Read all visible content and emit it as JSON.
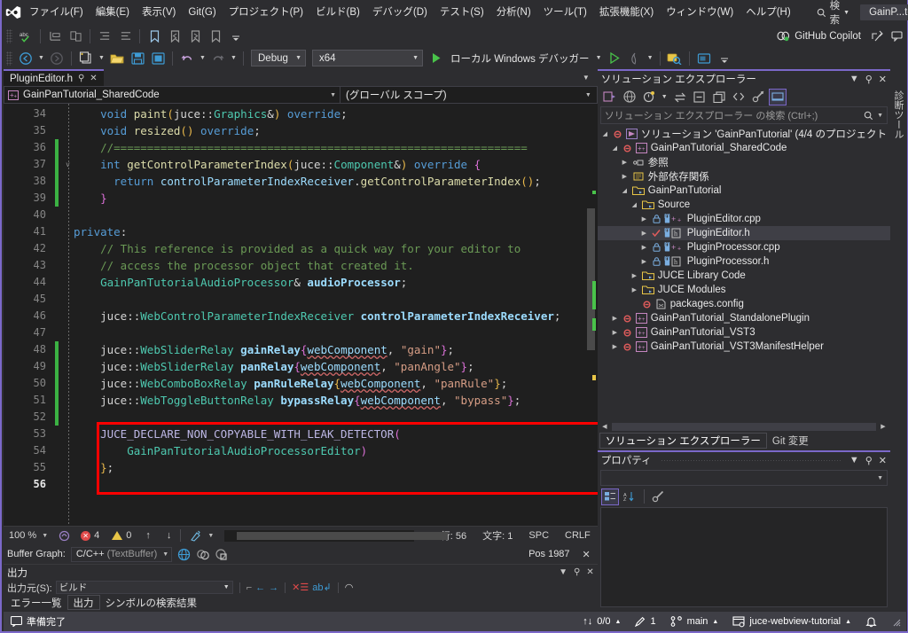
{
  "titlebar": {
    "logo_icon": "visual-studio-logo",
    "menus": [
      "ファイル(F)",
      "編集(E)",
      "表示(V)",
      "Git(G)",
      "プロジェクト(P)",
      "ビルド(B)",
      "デバッグ(D)",
      "テスト(S)",
      "分析(N)",
      "ツール(T)",
      "拡張機能(X)",
      "ウィンドウ(W)",
      "ヘルプ(H)"
    ],
    "search_label": "検索",
    "window_title": "GainP...torial",
    "minimize": "–",
    "maximize": "□",
    "close": "✕"
  },
  "toolbar": {
    "copilot_label": "GitHub Copilot",
    "config": "Debug",
    "platform": "x64",
    "run_label": "ローカル Windows デバッガー"
  },
  "editor": {
    "tab_name": "PluginEditor.h",
    "nav_project": "GainPanTutorial_SharedCode",
    "nav_scope": "(グローバル スコープ)",
    "first_line": 34,
    "lines": [
      {
        "n": 34,
        "marker": "none",
        "fold": "none"
      },
      {
        "n": 35,
        "marker": "none",
        "fold": "none"
      },
      {
        "n": 36,
        "marker": "saved",
        "fold": "none"
      },
      {
        "n": 37,
        "marker": "saved",
        "fold": "open"
      },
      {
        "n": 38,
        "marker": "saved",
        "fold": "none"
      },
      {
        "n": 39,
        "marker": "saved",
        "fold": "end"
      },
      {
        "n": 40,
        "marker": "none",
        "fold": "none"
      },
      {
        "n": 41,
        "marker": "none",
        "fold": "none"
      },
      {
        "n": 42,
        "marker": "none",
        "fold": "none"
      },
      {
        "n": 43,
        "marker": "none",
        "fold": "none"
      },
      {
        "n": 44,
        "marker": "none",
        "fold": "none"
      },
      {
        "n": 45,
        "marker": "none",
        "fold": "none"
      },
      {
        "n": 46,
        "marker": "none",
        "fold": "none"
      },
      {
        "n": 47,
        "marker": "none",
        "fold": "none"
      },
      {
        "n": 48,
        "marker": "unsaved",
        "fold": "none"
      },
      {
        "n": 49,
        "marker": "unsaved",
        "fold": "none"
      },
      {
        "n": 50,
        "marker": "unsaved",
        "fold": "none"
      },
      {
        "n": 51,
        "marker": "unsaved",
        "fold": "none"
      },
      {
        "n": 52,
        "marker": "unsaved",
        "fold": "none"
      },
      {
        "n": 53,
        "marker": "none",
        "fold": "none"
      },
      {
        "n": 54,
        "marker": "none",
        "fold": "none"
      },
      {
        "n": 55,
        "marker": "none",
        "fold": "end"
      },
      {
        "n": 56,
        "marker": "none",
        "fold": "none"
      }
    ],
    "code_text": [
      "    void paint(juce::Graphics&) override;",
      "    void resized() override;",
      "    //==============================================================",
      "    int getControlParameterIndex(juce::Component&) override {",
      "      return controlParameterIndexReceiver.getControlParameterIndex();",
      "    }",
      "",
      "private:",
      "    // This reference is provided as a quick way for your editor to",
      "    // access the processor object that created it.",
      "    GainPanTutorialAudioProcessor& audioProcessor;",
      "",
      "    juce::WebControlParameterIndexReceiver controlParameterIndexReceiver;",
      "",
      "    juce::WebSliderRelay gainRelay{webComponent, \"gain\"};",
      "    juce::WebSliderRelay panRelay{webComponent, \"panAngle\"};",
      "    juce::WebComboBoxRelay panRuleRelay{webComponent, \"panRule\"};",
      "    juce::WebToggleButtonRelay bypassRelay{webComponent, \"bypass\"};",
      "",
      "    JUCE_DECLARE_NON_COPYABLE_WITH_LEAK_DETECTOR(",
      "        GainPanTutorialAudioProcessorEditor)",
      "};",
      ""
    ],
    "status": {
      "zoom": "100 %",
      "error_count": "4",
      "warning_count": "0",
      "line_label": "行: 56",
      "col_label": "文字: 1",
      "spaces": "SPC",
      "eol": "CRLF",
      "buffer_graph_label": "Buffer Graph:",
      "buffer_type": "C/C++",
      "buffer_type_sub": "(TextBuffer)",
      "pos_label": "Pos 1987"
    }
  },
  "output_panel": {
    "title": "出力",
    "source_label": "出力元(S):",
    "source_value": "ビルド",
    "tabs": [
      {
        "label": "エラー一覧",
        "active": false
      },
      {
        "label": "出力",
        "active": true
      },
      {
        "label": "シンボルの検索結果",
        "active": false
      }
    ]
  },
  "solution_explorer": {
    "title": "ソリューション エクスプローラー",
    "search_placeholder": "ソリューション エクスプローラー の検索 (Ctrl+;)",
    "tree": [
      {
        "depth": 0,
        "label": "ソリューション 'GainPanTutorial' (4/4 のプロジェクト",
        "arrow": "down",
        "icon": "solution-icon",
        "selected": false
      },
      {
        "depth": 1,
        "label": "GainPanTutorial_SharedCode",
        "arrow": "down",
        "icon": "cpp-project-icon",
        "selected": false
      },
      {
        "depth": 2,
        "label": "参照",
        "arrow": "right",
        "icon": "references-icon",
        "selected": false
      },
      {
        "depth": 2,
        "label": "外部依存関係",
        "arrow": "right",
        "icon": "external-deps-icon",
        "selected": false
      },
      {
        "depth": 2,
        "label": "GainPanTutorial",
        "arrow": "down",
        "icon": "folder-icon",
        "selected": false
      },
      {
        "depth": 3,
        "label": "Source",
        "arrow": "down",
        "icon": "folder-icon",
        "selected": false
      },
      {
        "depth": 4,
        "label": "PluginEditor.cpp",
        "arrow": "right",
        "icon": "cpp-file-icon",
        "selected": false
      },
      {
        "depth": 4,
        "label": "PluginEditor.h",
        "arrow": "right",
        "icon": "header-file-icon",
        "selected": true
      },
      {
        "depth": 4,
        "label": "PluginProcessor.cpp",
        "arrow": "right",
        "icon": "cpp-file-icon",
        "selected": false
      },
      {
        "depth": 4,
        "label": "PluginProcessor.h",
        "arrow": "right",
        "icon": "header-file-icon",
        "selected": false
      },
      {
        "depth": 3,
        "label": "JUCE Library Code",
        "arrow": "right",
        "icon": "folder-icon",
        "selected": false
      },
      {
        "depth": 3,
        "label": "JUCE Modules",
        "arrow": "right",
        "icon": "folder-icon",
        "selected": false
      },
      {
        "depth": 3,
        "label": "packages.config",
        "arrow": "none",
        "icon": "config-file-icon",
        "selected": false
      },
      {
        "depth": 1,
        "label": "GainPanTutorial_StandalonePlugin",
        "arrow": "right",
        "icon": "cpp-project-icon",
        "selected": false
      },
      {
        "depth": 1,
        "label": "GainPanTutorial_VST3",
        "arrow": "right",
        "icon": "cpp-project-icon",
        "selected": false
      },
      {
        "depth": 1,
        "label": "GainPanTutorial_VST3ManifestHelper",
        "arrow": "right",
        "icon": "cpp-project-icon",
        "selected": false
      }
    ],
    "dock_tabs": [
      {
        "label": "ソリューション エクスプローラー",
        "active": true
      },
      {
        "label": "Git 変更",
        "active": false
      }
    ]
  },
  "properties": {
    "title": "プロパティ",
    "selected_object": ""
  },
  "vertical_dock": {
    "label": "診断ツール"
  },
  "statusbar": {
    "ready": "準備完了",
    "sync": "0/0",
    "pending_changes": "1",
    "branch": "main",
    "repo": "juce-webview-tutorial",
    "bell_icon": "notification-bell-icon"
  },
  "colors": {
    "accent": "#7b68c9",
    "highlight_box": "#ff0000",
    "statusbar_bg": "#3f3f46",
    "editor_bg": "#1f1f1f",
    "chrome_bg": "#2d2d30"
  }
}
